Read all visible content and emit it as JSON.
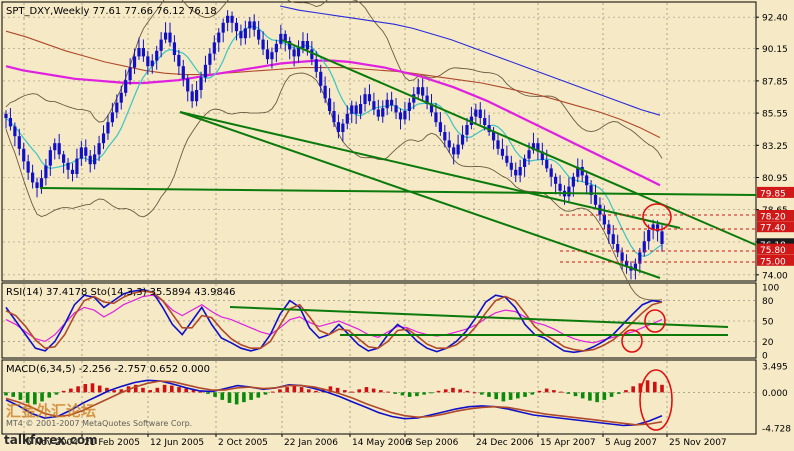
{
  "symbol_line": "SPT_DXY,Weekly  77.61 77.66 76.12 76.18",
  "rsi_header": "RSI(14) 37.4178  Sto(14,3,3) 35.5894 43.9846",
  "macd_header": "MACD(6,34,5) -2.256 -2.757 0.652 0.000",
  "watermark_cn": "汇金外汇论坛",
  "watermark_copyright": "MT4 © 2001-2007 MetaQuotes Software Corp.",
  "watermark_site": "talkforex.com",
  "colors": {
    "background": "#F5E9C6",
    "candle": "#1010C8",
    "channel": "#0B7A0B",
    "ma_pink": "#E020E0",
    "ma_brown": "#B04A2A",
    "ma_blue": "#2A2AD8",
    "bollinger": "#6B5A40",
    "ma_cyan": "#3AC4C4",
    "highlight_circle": "#E01010",
    "macd_up": "#D01010",
    "macd_down": "#0A8A0A",
    "price_label_red": "#D01818"
  },
  "chart_data": [
    {
      "type": "candlestick",
      "panel": "price",
      "y_ticks": [
        92.4,
        90.15,
        87.85,
        85.55,
        83.25,
        80.95,
        78.65,
        76.35,
        74.0
      ],
      "ylim": [
        73.7,
        93.2
      ],
      "price_labels": [
        {
          "text": "79.85",
          "value": 79.85,
          "color": "#D01818"
        },
        {
          "text": "78.20",
          "value": 78.2,
          "color": "#D01818"
        },
        {
          "text": "77.40",
          "value": 77.4,
          "color": "#D01818"
        },
        {
          "text": "76.18",
          "value": 76.18,
          "color": "#1A1A1A"
        },
        {
          "text": "75.80",
          "value": 75.8,
          "color": "#D01818"
        },
        {
          "text": "75.00",
          "value": 75.0,
          "color": "#D01818"
        }
      ],
      "x_labels": [
        "6 Nov 2004",
        "21 Feb 2005",
        "12 Jun 2005",
        "2 Oct 2005",
        "22 Jan 2006",
        "14 May 2006",
        "3 Sep 2006",
        "24 Dec 2006",
        "15 Apr 2007",
        "5 Aug 2007",
        "25 Nov 2007"
      ],
      "series_close": [
        85.2,
        84.6,
        83.9,
        83.0,
        82.1,
        81.3,
        80.6,
        80.2,
        80.9,
        81.8,
        82.9,
        83.4,
        82.6,
        82.0,
        81.5,
        81.2,
        82.3,
        83.1,
        82.5,
        81.9,
        82.6,
        83.4,
        84.1,
        84.9,
        85.6,
        86.3,
        87.0,
        87.9,
        88.8,
        89.6,
        90.2,
        89.6,
        88.9,
        89.3,
        90.0,
        90.8,
        91.3,
        90.6,
        89.7,
        88.9,
        88.0,
        87.1,
        86.4,
        87.2,
        88.1,
        89.0,
        89.8,
        90.6,
        91.3,
        92.0,
        92.5,
        92.0,
        91.4,
        90.9,
        91.6,
        92.1,
        91.5,
        90.8,
        90.1,
        89.4,
        89.9,
        90.5,
        91.2,
        90.7,
        90.1,
        89.6,
        90.2,
        90.7,
        90.1,
        89.4,
        88.5,
        87.5,
        86.6,
        85.7,
        84.9,
        84.2,
        84.8,
        85.5,
        86.1,
        85.5,
        86.2,
        86.9,
        86.4,
        85.8,
        85.3,
        85.9,
        86.5,
        86.1,
        85.6,
        85.1,
        85.7,
        86.3,
        86.9,
        87.4,
        86.8,
        86.2,
        85.6,
        84.9,
        84.2,
        83.6,
        83.1,
        82.6,
        83.3,
        84.0,
        84.7,
        85.3,
        85.8,
        85.2,
        84.7,
        84.2,
        83.6,
        83.0,
        82.5,
        82.0,
        81.5,
        81.1,
        81.7,
        82.3,
        82.9,
        83.4,
        82.8,
        82.2,
        81.6,
        81.0,
        80.5,
        80.0,
        79.6,
        80.3,
        81.0,
        81.7,
        81.1,
        80.4,
        79.7,
        79.0,
        78.3,
        77.6,
        76.9,
        76.2,
        75.6,
        75.0,
        74.6,
        74.3,
        74.8,
        75.6,
        76.4,
        77.2,
        77.6,
        77.1,
        76.2
      ],
      "series_ma_pink": [
        88.9,
        88.6,
        88.4,
        88.2,
        88.0,
        87.9,
        87.8,
        87.7,
        87.7,
        87.8,
        87.9,
        88.1,
        88.3,
        88.5,
        88.7,
        88.9,
        89.1,
        89.2,
        89.3,
        89.3,
        89.2,
        89.0,
        88.8,
        88.5,
        88.2,
        87.8,
        87.4,
        86.9,
        86.4,
        85.8,
        85.2,
        84.6,
        84.0,
        83.4,
        82.8,
        82.2,
        81.6,
        81.0,
        80.4
      ],
      "series_ma_brown": [
        91.4,
        91.0,
        90.5,
        90.0,
        89.6,
        89.2,
        88.9,
        88.6,
        88.4,
        88.3,
        88.3,
        88.4,
        88.5,
        88.6,
        88.7,
        88.8,
        88.8,
        88.8,
        88.7,
        88.6,
        88.5,
        88.3,
        88.1,
        87.9,
        87.7,
        87.4,
        87.1,
        86.8,
        86.4,
        86.0,
        85.6,
        85.1,
        84.5,
        83.8
      ],
      "series_ma_blue": [
        93.2,
        92.9,
        92.7,
        92.5,
        92.3,
        92.1,
        91.9,
        91.6,
        91.2,
        90.8,
        90.3,
        89.8,
        89.3,
        88.8,
        88.3,
        87.8,
        87.3,
        86.8,
        86.3,
        85.8,
        85.4
      ]
    },
    {
      "type": "line",
      "panel": "rsi_stochastic",
      "y_ticks": [
        "100",
        "80",
        "50",
        "20",
        "0"
      ],
      "ylim": [
        0,
        100
      ],
      "series": [
        {
          "values": [
            52,
            45,
            34,
            24,
            20,
            30,
            46,
            62,
            70,
            66,
            56,
            64,
            74,
            80,
            86,
            88,
            80,
            66,
            58,
            66,
            74,
            64,
            56,
            52,
            46,
            40,
            34,
            30,
            40,
            52,
            56,
            48,
            42,
            46,
            50,
            44,
            38,
            30,
            26,
            34,
            42,
            40,
            34,
            30,
            28,
            30,
            34,
            38,
            44,
            54,
            62,
            66,
            64,
            56,
            48,
            44,
            38,
            30,
            24,
            20,
            18,
            22,
            26,
            30,
            34,
            40,
            46,
            52
          ]
        },
        {
          "values": [
            70,
            50,
            30,
            10,
            6,
            20,
            45,
            74,
            88,
            85,
            70,
            80,
            90,
            94,
            96,
            92,
            70,
            45,
            30,
            50,
            70,
            45,
            25,
            18,
            10,
            6,
            10,
            30,
            60,
            80,
            70,
            40,
            25,
            30,
            45,
            30,
            15,
            6,
            10,
            30,
            45,
            35,
            20,
            10,
            5,
            10,
            20,
            35,
            55,
            78,
            88,
            85,
            70,
            45,
            30,
            25,
            15,
            6,
            4,
            6,
            12,
            20,
            30,
            45,
            60,
            74,
            80,
            78
          ]
        },
        {
          "values": [
            65,
            58,
            42,
            22,
            10,
            12,
            30,
            58,
            80,
            86,
            78,
            76,
            85,
            91,
            94,
            92,
            80,
            60,
            40,
            40,
            58,
            55,
            38,
            24,
            15,
            10,
            10,
            20,
            44,
            68,
            74,
            56,
            36,
            30,
            38,
            36,
            24,
            12,
            10,
            20,
            36,
            38,
            28,
            16,
            10,
            10,
            15,
            26,
            42,
            62,
            80,
            86,
            80,
            62,
            42,
            30,
            22,
            12,
            8,
            6,
            8,
            14,
            22,
            34,
            48,
            62,
            74,
            78
          ]
        }
      ]
    },
    {
      "type": "bar",
      "panel": "macd",
      "y_ticks": [
        "3.495",
        "0.000",
        "-4.728"
      ],
      "ylim": [
        -4.728,
        3.495
      ],
      "values": [
        -0.4,
        -0.6,
        -1.0,
        -1.4,
        -1.6,
        -1.2,
        -0.7,
        -0.3,
        0.2,
        0.5,
        0.8,
        1.1,
        1.2,
        0.9,
        0.6,
        0.3,
        0.4,
        0.8,
        1.0,
        0.6,
        0.3,
        0.6,
        1.0,
        0.9,
        0.7,
        0.5,
        0.3,
        0.1,
        -0.2,
        -0.6,
        -1.0,
        -1.4,
        -1.6,
        -1.3,
        -1.0,
        -0.7,
        -0.3,
        0.1,
        0.4,
        0.7,
        0.9,
        0.7,
        0.4,
        0.2,
        0.5,
        0.8,
        0.6,
        0.3,
        0.1,
        0.4,
        0.7,
        0.5,
        0.3,
        0.1,
        -0.2,
        -0.4,
        -0.6,
        -0.5,
        -0.3,
        -0.1,
        0.2,
        0.4,
        0.6,
        0.4,
        0.2,
        0.0,
        -0.3,
        -0.6,
        -0.9,
        -1.2,
        -1.0,
        -0.8,
        -0.6,
        -0.3,
        0.2,
        0.5,
        0.3,
        0.1,
        -0.2,
        -0.5,
        -0.8,
        -1.1,
        -1.3,
        -1.0,
        -0.6,
        -0.2,
        0.3,
        0.8,
        1.2,
        1.6,
        1.4,
        1.0
      ],
      "series": [
        {
          "values": [
            -1.0,
            -1.8,
            -2.8,
            -3.4,
            -3.2,
            -2.4,
            -1.4,
            -0.6,
            0.2,
            0.8,
            1.3,
            1.6,
            1.5,
            1.1,
            0.6,
            0.2,
            0.1,
            0.5,
            0.9,
            0.7,
            0.4,
            0.6,
            1.0,
            0.9,
            0.5,
            0.0,
            -0.6,
            -1.3,
            -2.0,
            -2.7,
            -3.2,
            -3.5,
            -3.4,
            -3.0,
            -2.6,
            -2.2,
            -1.9,
            -1.8,
            -1.9,
            -2.2,
            -2.6,
            -3.0,
            -3.2,
            -3.4,
            -3.6,
            -3.8,
            -4.0,
            -4.2,
            -4.4,
            -4.3,
            -3.8,
            -3.1
          ]
        },
        {
          "values": [
            -0.8,
            -1.3,
            -2.0,
            -2.8,
            -3.2,
            -3.0,
            -2.4,
            -1.6,
            -0.8,
            0.0,
            0.7,
            1.2,
            1.5,
            1.4,
            1.0,
            0.6,
            0.3,
            0.3,
            0.6,
            0.7,
            0.5,
            0.6,
            0.9,
            0.9,
            0.7,
            0.3,
            -0.2,
            -0.8,
            -1.5,
            -2.1,
            -2.7,
            -3.1,
            -3.3,
            -3.2,
            -2.9,
            -2.5,
            -2.2,
            -2.0,
            -1.9,
            -2.0,
            -2.3,
            -2.6,
            -2.9,
            -3.1,
            -3.3,
            -3.5,
            -3.7,
            -3.9,
            -4.1,
            -4.3,
            -4.2,
            -3.9
          ]
        }
      ]
    }
  ]
}
